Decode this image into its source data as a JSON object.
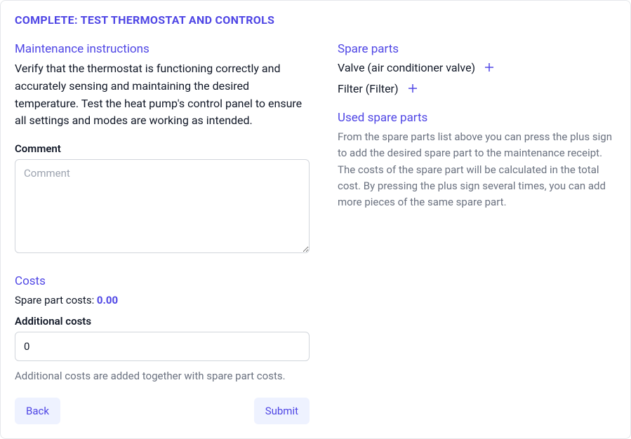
{
  "page_title": "COMPLETE: TEST THERMOSTAT AND CONTROLS",
  "left": {
    "instructions_heading": "Maintenance instructions",
    "instructions_text": "Verify that the thermostat is functioning correctly and accurately sensing and maintaining the desired temperature. Test the heat pump's control panel to ensure all settings and modes are working as intended.",
    "comment_label": "Comment",
    "comment_placeholder": "Comment",
    "comment_value": "",
    "costs_heading": "Costs",
    "spare_costs_label": "Spare part costs: ",
    "spare_costs_value": "0.00",
    "additional_costs_label": "Additional costs",
    "additional_costs_value": "0",
    "additional_costs_help": "Additional costs are added together with spare part costs.",
    "back_button": "Back",
    "submit_button": "Submit"
  },
  "right": {
    "spare_parts_heading": "Spare parts",
    "spare_parts": [
      {
        "label": "Valve (air conditioner valve)"
      },
      {
        "label": "Filter (Filter)"
      }
    ],
    "used_heading": "Used spare parts",
    "used_desc": "From the spare parts list above you can press the plus sign to add the desired spare part to the maintenance receipt. The costs of the spare part will be calculated in the total cost. By pressing the plus sign several times, you can add more pieces of the same spare part."
  }
}
